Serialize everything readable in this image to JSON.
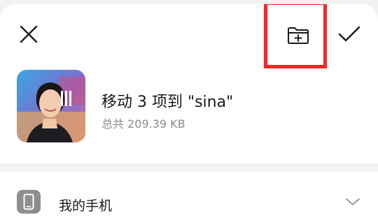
{
  "dialog": {
    "move_title": "移动 3 项到 \"sina\"",
    "total_size": "总共 209.39 KB"
  },
  "toolbar": {
    "close_icon": "close-icon",
    "new_folder_icon": "folder-add-icon",
    "confirm_icon": "checkmark-icon",
    "highlight_color": "#ff2323"
  },
  "location": {
    "label": "我的手机",
    "icon": "phone-icon",
    "chevron": "chevron-down-icon"
  }
}
